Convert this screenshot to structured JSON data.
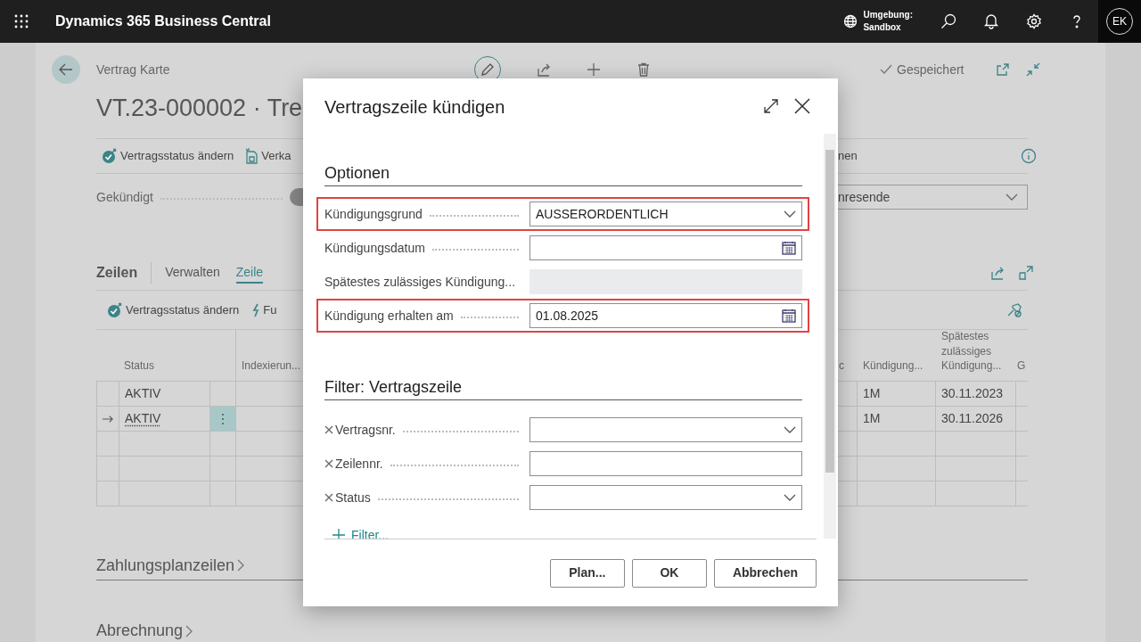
{
  "app_bar": {
    "title": "Dynamics 365 Business Central",
    "environment_label": "Umgebung:",
    "environment": "Sandbox",
    "avatar": "EK"
  },
  "page": {
    "breadcrumb": "Vertrag Karte",
    "status": "Gespeichert",
    "title": "VT.23-000002 · Tre",
    "actions_left": [
      "Vertragsstatus ändern",
      "Verka"
    ],
    "actions_right": [
      "nen"
    ],
    "field": {
      "label": "Gekündigt",
      "on": false
    },
    "dropdown_value": "nresende",
    "lines": {
      "title": "Zeilen",
      "tabs": [
        {
          "label": "Verwalten",
          "selected": false
        },
        {
          "label": "Zeile",
          "selected": true
        }
      ],
      "actions": [
        "Vertragsstatus ändern",
        "Fu"
      ],
      "columns_left": [
        "Status",
        "Indexierun..."
      ],
      "columns_right": [
        "c",
        "Kündigung...",
        "Spätestes zulässiges Kündigung...",
        "G"
      ],
      "rows": [
        {
          "status": "AKTIV",
          "current": false,
          "cells": [
            "1M",
            "30.11.2023"
          ]
        },
        {
          "status": "AKTIV",
          "current": true,
          "cells": [
            "1M",
            "30.11.2026"
          ]
        }
      ]
    },
    "sections": [
      "Zahlungsplanzeilen",
      "Abrechnung"
    ]
  },
  "dialog": {
    "title": "Vertragszeile kündigen",
    "sections": [
      {
        "heading": "Optionen",
        "fields": [
          {
            "kind": "dropdown",
            "label": "Kündigungsgrund",
            "value": "AUSSERORDENTLICH",
            "highlighted": true,
            "removable": false
          },
          {
            "kind": "date",
            "label": "Kündigungsdatum",
            "highlighted": false,
            "removable": false
          },
          {
            "kind": "readonly",
            "label": "Spätestes zulässiges Kündigung...",
            "highlighted": false,
            "removable": false
          },
          {
            "kind": "date",
            "label": "Kündigung erhalten am",
            "value": "01.08.2025",
            "highlighted": true,
            "removable": false
          }
        ]
      },
      {
        "heading": "Filter: Vertragszeile",
        "fields": [
          {
            "kind": "dropdown",
            "label": "Vertragsnr.",
            "highlighted": false,
            "removable": true
          },
          {
            "kind": "text",
            "label": "Zeilennr.",
            "highlighted": false,
            "removable": true
          },
          {
            "kind": "dropdown",
            "label": "Status",
            "highlighted": false,
            "removable": true
          }
        ]
      }
    ],
    "add_filter": "Filter...",
    "buttons": [
      "Plan...",
      "OK",
      "Abbrechen"
    ]
  }
}
